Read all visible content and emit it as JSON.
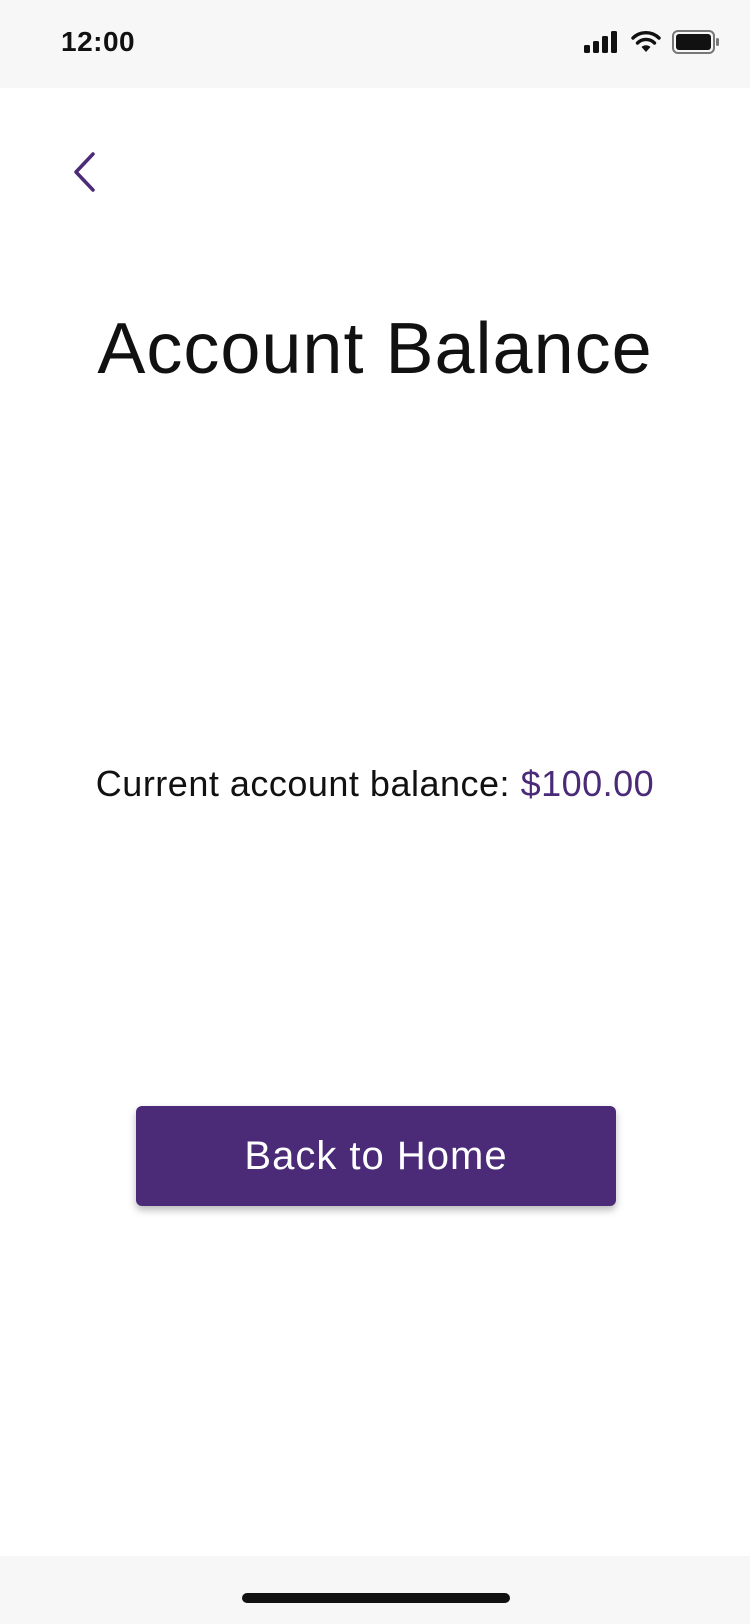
{
  "status_bar": {
    "time": "12:00",
    "icons": [
      "signal-icon",
      "wifi-icon",
      "battery-icon"
    ]
  },
  "nav": {
    "back_icon": "chevron-left-icon"
  },
  "page": {
    "title": "Account Balance",
    "balance_label": "Current account balance:",
    "balance_value": "$100.00"
  },
  "actions": {
    "home_button_label": "Back to Home"
  },
  "colors": {
    "accent": "#4b2a78",
    "text": "#111111",
    "status_bar_bg": "#f7f7f7",
    "background": "#ffffff"
  }
}
